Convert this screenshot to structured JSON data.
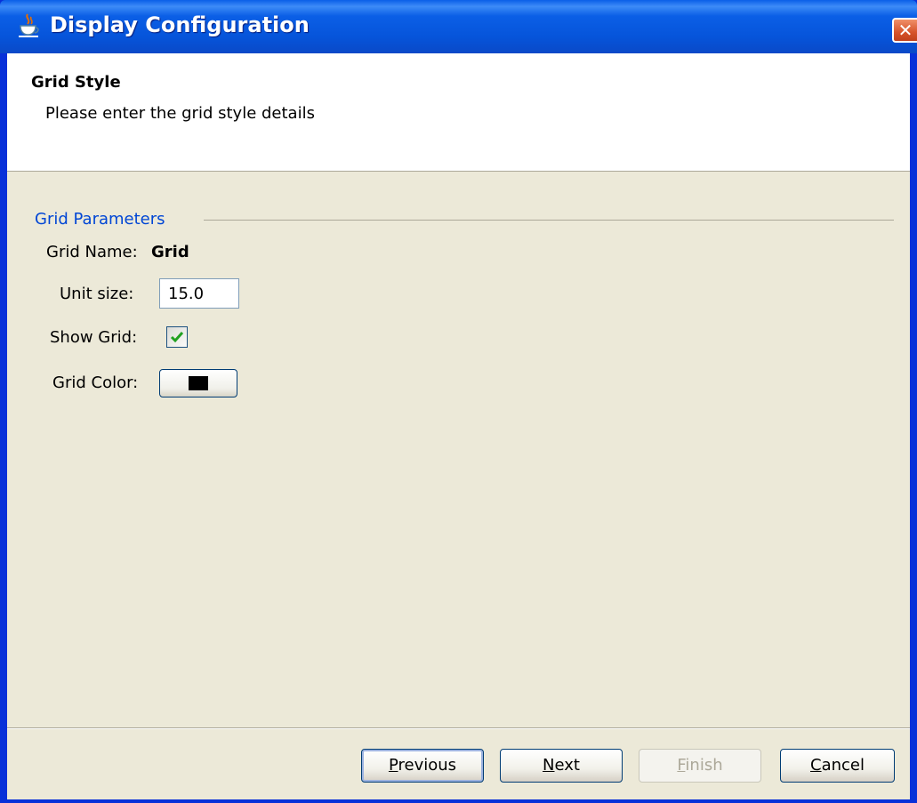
{
  "window": {
    "title": "Display Configuration"
  },
  "header": {
    "title": "Grid Style",
    "subtitle": "Please enter the grid style details"
  },
  "group": {
    "legend": "Grid Parameters",
    "grid_name_label": "Grid Name:",
    "grid_name_value": "Grid",
    "unit_size_label": "Unit size:",
    "unit_size_value": "15.0",
    "show_grid_label": "Show Grid:",
    "show_grid_checked": true,
    "grid_color_label": "Grid Color:",
    "grid_color_value": "#000000"
  },
  "buttons": {
    "previous": {
      "mnemonic": "P",
      "rest": "revious"
    },
    "next": {
      "mnemonic": "N",
      "rest": "ext"
    },
    "finish": {
      "mnemonic": "F",
      "rest": "inish",
      "disabled": true
    },
    "cancel": {
      "mnemonic": "C",
      "rest": "ancel"
    }
  },
  "colors": {
    "title_bar": "#0654da",
    "legend_text": "#0046d5",
    "panel_bg": "#ece9d8",
    "checkmark": "#21a121"
  }
}
